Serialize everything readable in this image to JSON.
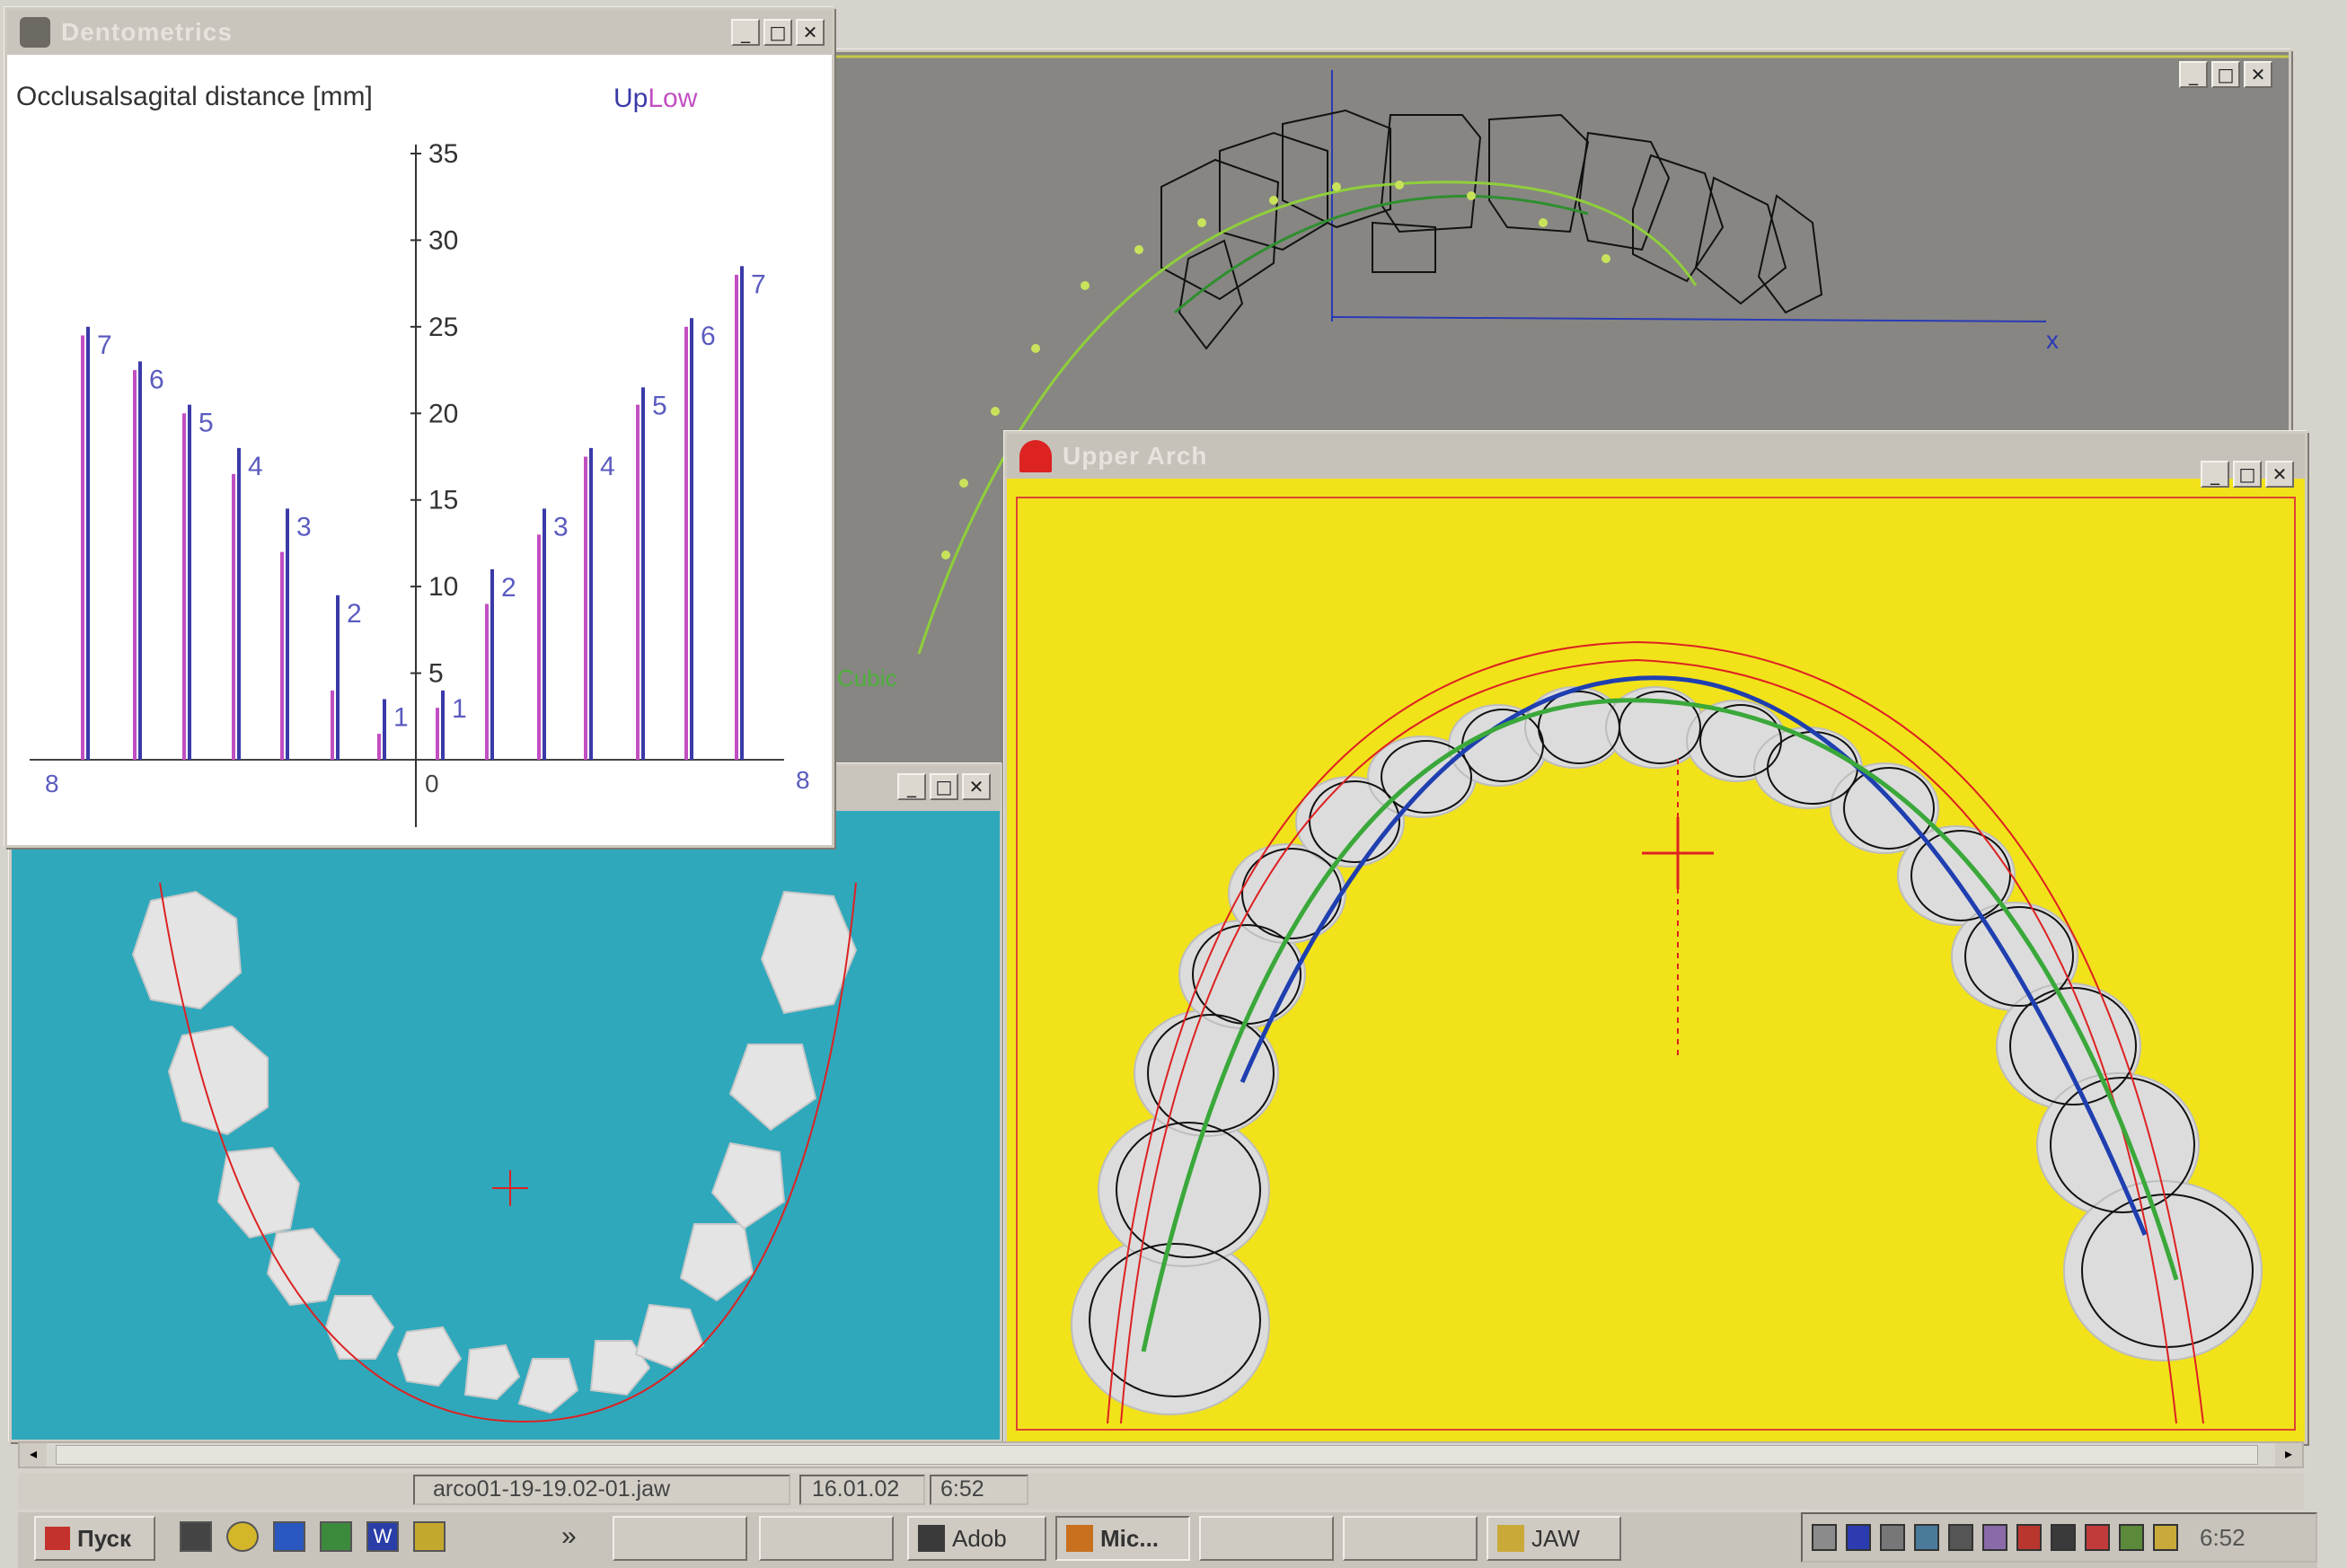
{
  "dentometrics": {
    "title": "Dentometrics",
    "heading": "Occlusalsagital distance [mm]",
    "legend_up": "Up",
    "legend_low": "Low",
    "x_left_label": "8",
    "x_right_label": "8",
    "x_zero_label": "0",
    "colors": {
      "up": "#3a3aa8",
      "low": "#c24fc2"
    }
  },
  "chart_data": {
    "type": "bar",
    "title": "Occlusalsagital distance [mm]",
    "ylim": [
      0,
      35
    ],
    "y_ticks": [
      5,
      10,
      15,
      20,
      25,
      30,
      35
    ],
    "categories": [
      "7",
      "6",
      "5",
      "4",
      "3",
      "2",
      "1",
      "1",
      "2",
      "3",
      "4",
      "5",
      "6",
      "7"
    ],
    "series": [
      {
        "name": "Up",
        "values": [
          25,
          23,
          20.5,
          18,
          14.5,
          9.5,
          3.5,
          4,
          11,
          14.5,
          18,
          21.5,
          25.5,
          28.5
        ]
      },
      {
        "name": "Low",
        "values": [
          24.5,
          22.5,
          20,
          16.5,
          12,
          4,
          1.5,
          3,
          9,
          13,
          17.5,
          20.5,
          25,
          28
        ]
      }
    ]
  },
  "occlusal_window": {
    "axis_label": "x",
    "curve_label": "Cubic"
  },
  "lower_window": {},
  "upper_arch": {
    "title": "Upper  Arch"
  },
  "status_bar": {
    "file": "arco01-19-19.02-01.jaw",
    "date": "16.01.02",
    "time": "6:52"
  },
  "taskbar": {
    "start_label": "Пуск",
    "chevron": "»",
    "tasks": [
      {
        "label": ""
      },
      {
        "label": ""
      },
      {
        "label": "Adob"
      },
      {
        "label": "Mic..."
      },
      {
        "label": ""
      },
      {
        "label": ""
      },
      {
        "label": "JAW"
      }
    ],
    "clock": "6:52"
  }
}
